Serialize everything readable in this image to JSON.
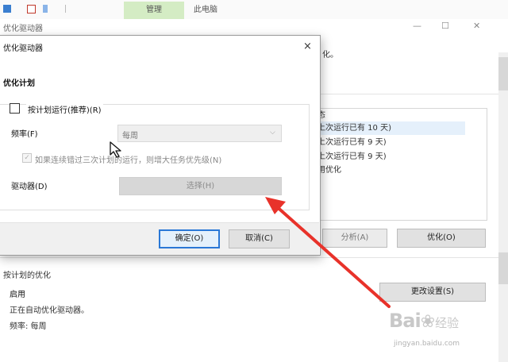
{
  "ribbon": {
    "tab_manage": "管理",
    "tab_pc": "此电脑"
  },
  "main_window": {
    "title": "优化驱动器",
    "description": "化。",
    "status_header": "态",
    "status_rows": [
      "上次运行已有 10 天)",
      "上次运行已有 9 天)",
      "上次运行已有 9 天)",
      "用优化"
    ],
    "analyze_label": "分析(A)",
    "optimize_label": "优化(O)",
    "schedule": {
      "title": "按计划的优化",
      "state": "启用",
      "description": "正在自动优化驱动器。",
      "frequency": "频率: 每周",
      "change_label": "更改设置(S)"
    }
  },
  "dialog": {
    "title": "优化驱动器",
    "close_icon": "×",
    "heading": "优化计划",
    "run_on_schedule": {
      "label": "按计划运行(推荐)(R)",
      "checked": false
    },
    "frequency_label": "频率(F)",
    "frequency_value": "每周",
    "priority_check": {
      "label": "如果连续错过三次计划的运行，则增大任务优先级(N)",
      "checked": true,
      "mark": "✓"
    },
    "drives_label": "驱动器(D)",
    "select_label": "选择(H)",
    "ok_label": "确定(O)",
    "cancel_label": "取消(C)"
  },
  "watermark": {
    "brand": "Bai",
    "brand_suffix": "经验",
    "url": "jingyan.baidu.com"
  },
  "colors": {
    "accent": "#2a78d6",
    "ribbon_manage": "#d4ecc4",
    "annotation_arrow": "#e8322a"
  }
}
